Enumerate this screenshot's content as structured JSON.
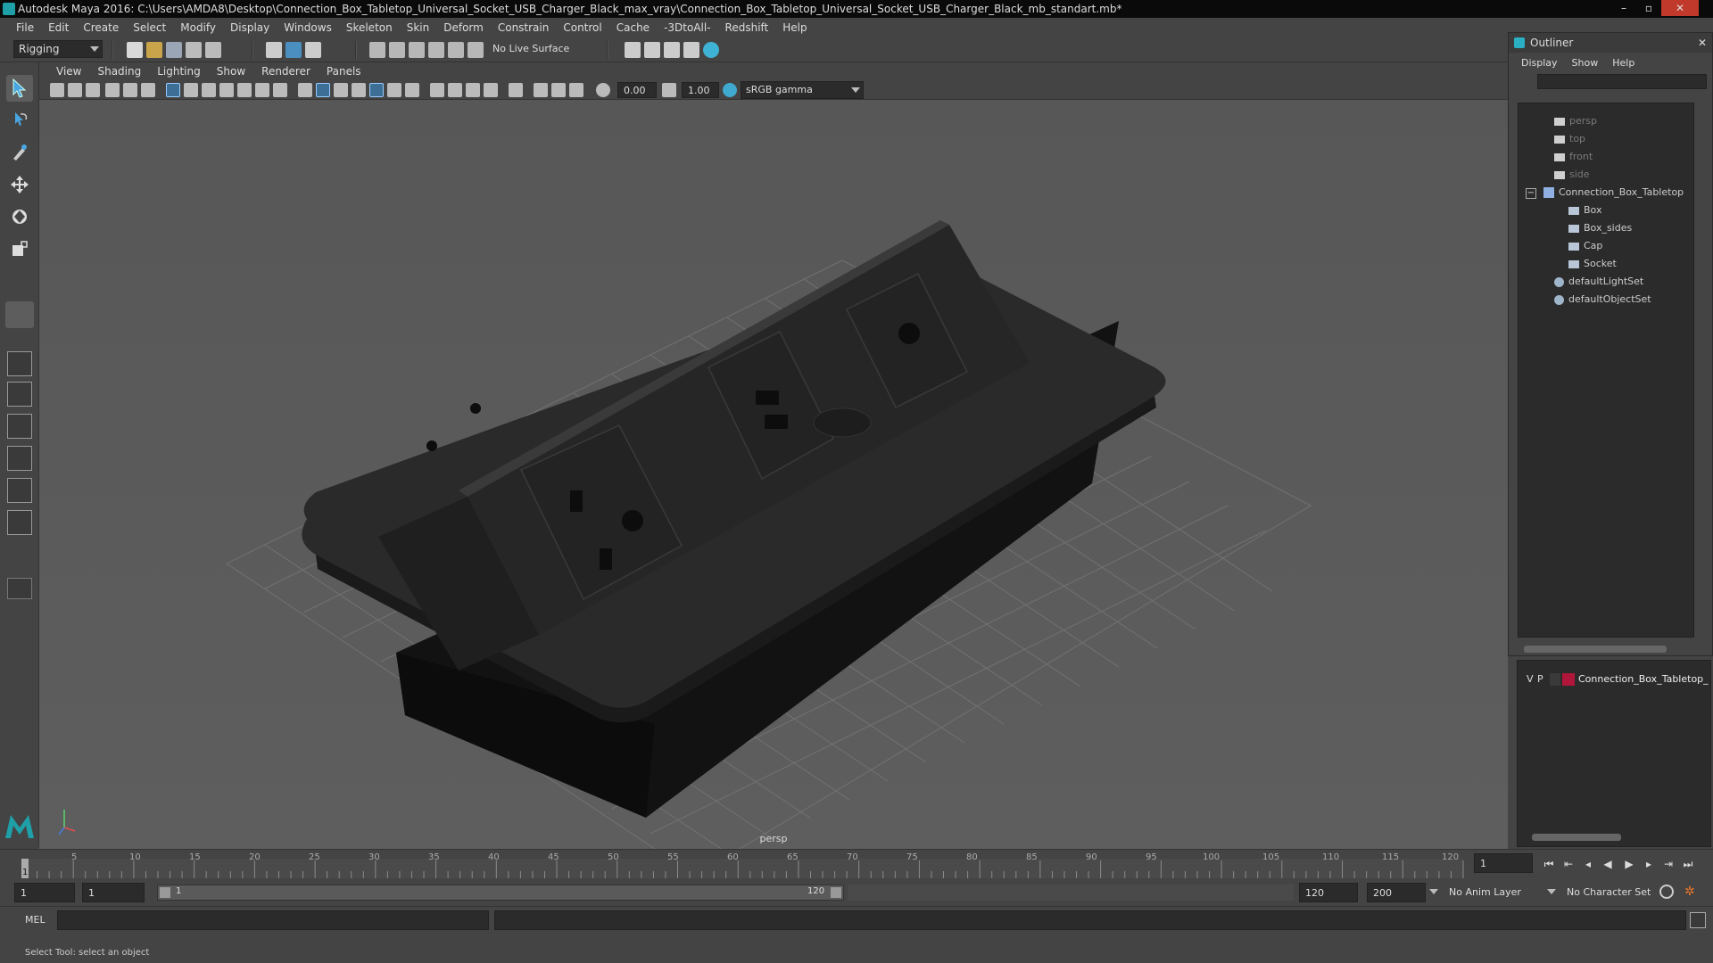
{
  "window": {
    "title": "Autodesk Maya 2016: C:\\Users\\AMDA8\\Desktop\\Connection_Box_Tabletop_Universal_Socket_USB_Charger_Black_max_vray\\Connection_Box_Tabletop_Universal_Socket_USB_Charger_Black_mb_standart.mb*",
    "min": "–",
    "max": "▫",
    "close": "✕"
  },
  "menubar": [
    "File",
    "Edit",
    "Create",
    "Select",
    "Modify",
    "Display",
    "Windows",
    "Skeleton",
    "Skin",
    "Deform",
    "Constrain",
    "Control",
    "Cache",
    "-3DtoAll-",
    "Redshift",
    "Help"
  ],
  "statusline": {
    "mode": "Rigging",
    "live_surface": "No Live Surface"
  },
  "panel": {
    "menu": [
      "View",
      "Shading",
      "Lighting",
      "Show",
      "Renderer",
      "Panels"
    ],
    "exposure": "0.00",
    "gamma": "1.00",
    "colorspace": "sRGB gamma",
    "camera": "persp"
  },
  "outliner": {
    "title": "Outliner",
    "menu": [
      "Display",
      "Show",
      "Help"
    ],
    "items": [
      {
        "label": "persp",
        "type": "camera",
        "indent": 0,
        "dim": true
      },
      {
        "label": "top",
        "type": "camera",
        "indent": 0,
        "dim": true
      },
      {
        "label": "front",
        "type": "camera",
        "indent": 0,
        "dim": true
      },
      {
        "label": "side",
        "type": "camera",
        "indent": 0,
        "dim": true
      },
      {
        "label": "Connection_Box_Tabletop",
        "type": "group",
        "indent": 0,
        "dim": false
      },
      {
        "label": "Box",
        "type": "mesh",
        "indent": 1,
        "dim": false
      },
      {
        "label": "Box_sides",
        "type": "mesh",
        "indent": 1,
        "dim": false
      },
      {
        "label": "Cap",
        "type": "mesh",
        "indent": 1,
        "dim": false
      },
      {
        "label": "Socket",
        "type": "mesh",
        "indent": 1,
        "dim": false
      },
      {
        "label": "defaultLightSet",
        "type": "set",
        "indent": 0,
        "dim": false
      },
      {
        "label": "defaultObjectSet",
        "type": "set",
        "indent": 0,
        "dim": false
      }
    ]
  },
  "layers": {
    "row": {
      "v": "V",
      "p": "P",
      "name": "Connection_Box_Tabletop_U",
      "color": "#b0153a"
    }
  },
  "timeline": {
    "ticks": [
      "5",
      "10",
      "15",
      "20",
      "25",
      "30",
      "35",
      "40",
      "45",
      "50",
      "55",
      "60",
      "65",
      "70",
      "75",
      "80",
      "85",
      "90",
      "95",
      "100",
      "105",
      "110",
      "115",
      "120"
    ],
    "current": "1",
    "current_field": "1"
  },
  "range": {
    "start": "1",
    "playback_start": "1",
    "slider_start": "1",
    "slider_end": "120",
    "playback_end": "120",
    "end": "200",
    "anim_layer": "No Anim Layer",
    "char_set": "No Character Set"
  },
  "cmdline": {
    "label": "MEL"
  },
  "helpline": {
    "text": "Select Tool: select an object"
  },
  "colors": {
    "accent": "#1fa0a8",
    "layer": "#b0153a",
    "viewport": "#5a5a5a"
  }
}
